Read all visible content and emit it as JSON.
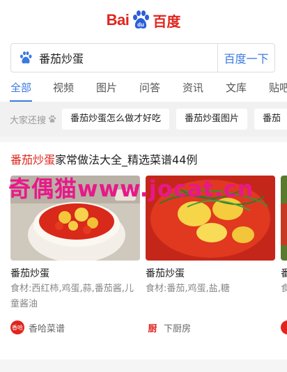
{
  "logo": {
    "text_latin": "Bai",
    "text_du": "du",
    "text_cn": "百度"
  },
  "search": {
    "value": "番茄炒蛋",
    "button": "百度一下"
  },
  "tabs": [
    "全部",
    "视频",
    "图片",
    "问答",
    "资讯",
    "文库",
    "贴吧"
  ],
  "related": {
    "label": "大家还搜",
    "chips": [
      "番茄炒蛋怎么做才好吃",
      "番茄炒蛋图片",
      "番茄"
    ]
  },
  "result": {
    "title_highlight": "番茄炒蛋",
    "title_rest": "家常做法大全_精选菜谱44例",
    "watermark": "奇偶猫www.jocat.cn",
    "recipes": [
      {
        "name": "番茄炒蛋",
        "ingredients": "食材:西红柿,鸡蛋,蒜,番茄酱,儿童酱油",
        "source": "香哈菜谱",
        "source_icon": "香哈"
      },
      {
        "name": "番茄炒蛋",
        "ingredients": "食材:番茄,鸡蛋,盐,糖",
        "source": "下厨房",
        "source_icon": "厨"
      },
      {
        "name": "番",
        "ingredients": "食材:盐",
        "source": "",
        "source_icon": ""
      }
    ]
  },
  "colors": {
    "brand_red": "#e0251e",
    "link_blue": "#3a79e0",
    "watermark": "#e8188a"
  }
}
